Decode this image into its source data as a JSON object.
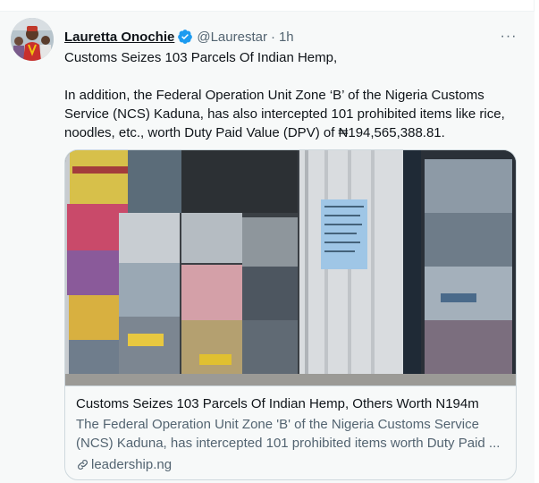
{
  "author": {
    "name": "Lauretta Onochie",
    "handle": "@Laurestar",
    "separator": "·",
    "time": "1h",
    "verified": true
  },
  "more_label": "···",
  "tweet": {
    "line1": "Customs Seizes 103 Parcels Of Indian Hemp,",
    "line2": "In addition, the Federal Operation Unit Zone ‘B’ of the Nigeria Customs Service (NCS) Kaduna, has also intercepted 101 prohibited items like rice, noodles, etc., worth Duty Paid Value (DPV) of ₦194,565,388.81."
  },
  "card": {
    "title": "Customs Seizes 103 Parcels Of Indian Hemp, Others Worth N194m",
    "description": "The Federal Operation Unit Zone 'B' of the Nigeria Customs Service (NCS) Kaduna, has intercepted 101 prohibited items worth Duty Paid ...",
    "domain": "leadership.ng"
  },
  "colors": {
    "accent": "#1d9bf0",
    "text": "#0f1419",
    "secondary": "#536471",
    "border": "#cfd9de",
    "background": "#f7f9f9"
  }
}
